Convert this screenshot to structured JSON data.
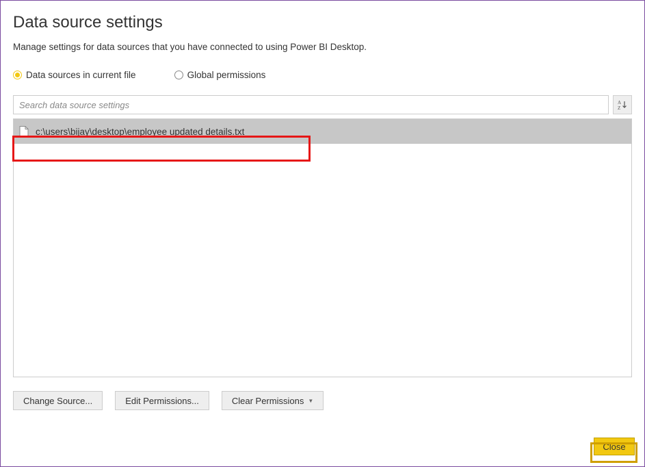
{
  "title": "Data source settings",
  "subtitle": "Manage settings for data sources that you have connected to using Power BI Desktop.",
  "radio": {
    "current_file": "Data sources in current file",
    "global_permissions": "Global permissions"
  },
  "search": {
    "placeholder": "Search data source settings"
  },
  "list": {
    "items": [
      {
        "label": "c:\\users\\bijay\\desktop\\employee updated details.txt"
      }
    ]
  },
  "buttons": {
    "change_source": "Change Source...",
    "edit_permissions": "Edit Permissions...",
    "clear_permissions": "Clear Permissions"
  },
  "close": "Close"
}
